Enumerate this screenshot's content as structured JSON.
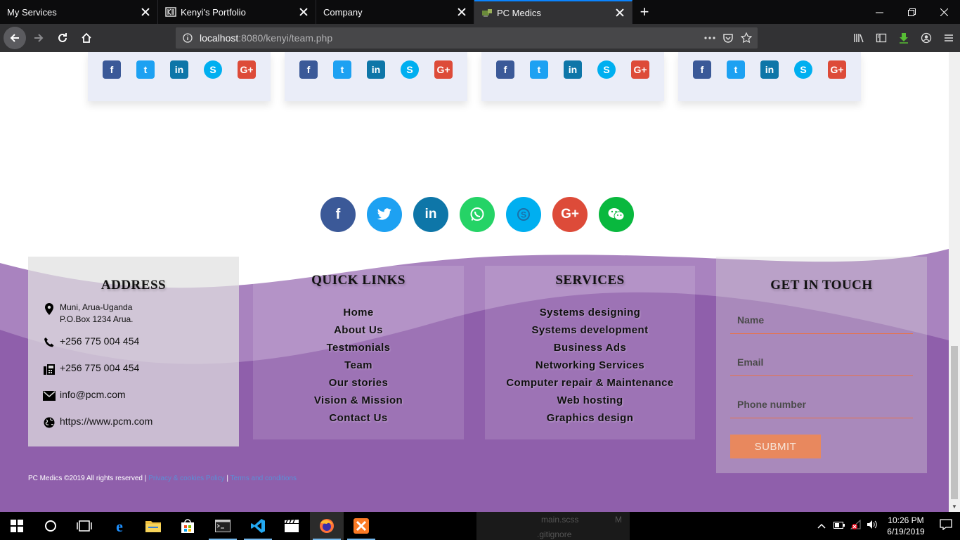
{
  "browser": {
    "tabs": [
      {
        "title": "My Services",
        "active": false
      },
      {
        "title": "Kenyi's Portfolio",
        "active": false
      },
      {
        "title": "Company",
        "active": false
      },
      {
        "title": "PC Medics",
        "active": true
      }
    ],
    "url_host": "localhost",
    "url_path": ":8080/kenyi/team.php"
  },
  "team_cards": {
    "count": 4,
    "icons": [
      "facebook-square",
      "twitter-square",
      "linkedin-square",
      "skype",
      "google-plus-square"
    ]
  },
  "social_circles": [
    {
      "name": "facebook",
      "color": "#3b5998"
    },
    {
      "name": "twitter",
      "color": "#1da1f2"
    },
    {
      "name": "linkedin",
      "color": "#0e76a8"
    },
    {
      "name": "whatsapp",
      "color": "#25d366"
    },
    {
      "name": "skype",
      "color": "#00aff0"
    },
    {
      "name": "google-plus",
      "color": "#dd4b39"
    },
    {
      "name": "wechat",
      "color": "#09b83e"
    }
  ],
  "footer": {
    "address": {
      "heading": "ADDRESS",
      "line1": "Muni, Arua-Uganda",
      "line2": "P.O.Box 1234 Arua.",
      "phone": "+256 775 004 454",
      "fax": "+256 775 004 454",
      "email": "info@pcm.com",
      "website": "https://www.pcm.com"
    },
    "quick_links": {
      "heading": "QUICK LINKS",
      "items": [
        "Home",
        "About Us",
        "Testmonials",
        "Team",
        "Our stories",
        "Vision & Mission",
        "Contact Us"
      ]
    },
    "services": {
      "heading": "SERVICES",
      "items": [
        "Systems designing",
        "Systems development",
        "Business Ads",
        "Networking Services",
        "Computer repair & Maintenance",
        "Web hosting",
        "Graphics design"
      ]
    },
    "contact": {
      "heading": "GET IN TOUCH",
      "name_placeholder": "Name",
      "email_placeholder": "Email",
      "phone_placeholder": "Phone number",
      "submit_label": "SUBMIT"
    },
    "copyright": "PC Medics ©2019 All rights reserved |",
    "privacy_link": "Privacy & cookies Policy",
    "separator": "|",
    "terms_link": "Terms and conditions"
  },
  "colors": {
    "footer_purple": "#8e5ea9",
    "accent_orange": "#e8734a",
    "card_bg": "#eaedf8"
  },
  "taskbar": {
    "ghost_file1": "main.scss",
    "ghost_file1_badge": "M",
    "ghost_file2": ".gitignore",
    "time": "10:26 PM",
    "date": "6/19/2019"
  }
}
